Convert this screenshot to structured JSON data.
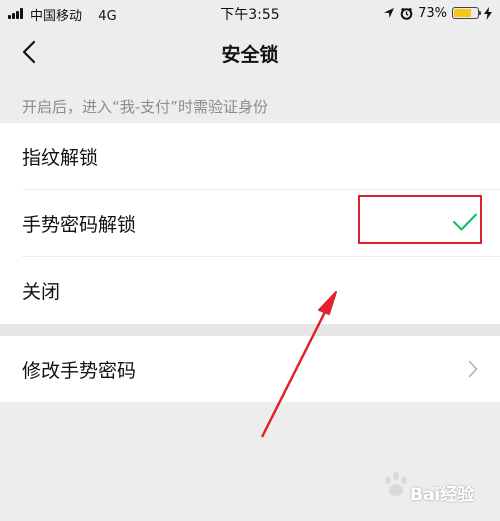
{
  "status_bar": {
    "carrier": "中国移动",
    "network": "4G",
    "time": "下午3:55",
    "battery_percent_label": "73%",
    "battery_level": 0.73,
    "battery_color": "#f5c518",
    "icons": [
      "signal-icon",
      "location-icon",
      "alarm-icon",
      "battery-icon",
      "charging-icon"
    ]
  },
  "nav": {
    "back_icon": "chevron-left-icon",
    "title": "安全锁"
  },
  "hint": "开启后，进入“我-支付”时需验证身份",
  "options": [
    {
      "label": "指纹解锁",
      "selected": false
    },
    {
      "label": "手势密码解锁",
      "selected": true
    },
    {
      "label": "关闭",
      "selected": false
    }
  ],
  "accent_color": "#07c160",
  "change_password": {
    "label": "修改手势密码",
    "icon": "chevron-right-icon"
  },
  "annotation": {
    "highlight_color": "#e0222a",
    "arrow_color": "#e0222a"
  },
  "watermark": "Bai经验"
}
